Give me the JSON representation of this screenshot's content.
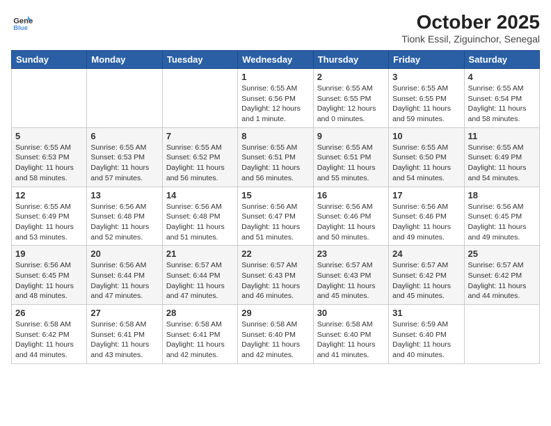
{
  "header": {
    "logo_line1": "General",
    "logo_line2": "Blue",
    "title": "October 2025",
    "subtitle": "Tionk Essil, Ziguinchor, Senegal"
  },
  "weekdays": [
    "Sunday",
    "Monday",
    "Tuesday",
    "Wednesday",
    "Thursday",
    "Friday",
    "Saturday"
  ],
  "weeks": [
    [
      {
        "day": "",
        "info": ""
      },
      {
        "day": "",
        "info": ""
      },
      {
        "day": "",
        "info": ""
      },
      {
        "day": "1",
        "info": "Sunrise: 6:55 AM\nSunset: 6:56 PM\nDaylight: 12 hours\nand 1 minute."
      },
      {
        "day": "2",
        "info": "Sunrise: 6:55 AM\nSunset: 6:55 PM\nDaylight: 12 hours\nand 0 minutes."
      },
      {
        "day": "3",
        "info": "Sunrise: 6:55 AM\nSunset: 6:55 PM\nDaylight: 11 hours\nand 59 minutes."
      },
      {
        "day": "4",
        "info": "Sunrise: 6:55 AM\nSunset: 6:54 PM\nDaylight: 11 hours\nand 58 minutes."
      }
    ],
    [
      {
        "day": "5",
        "info": "Sunrise: 6:55 AM\nSunset: 6:53 PM\nDaylight: 11 hours\nand 58 minutes."
      },
      {
        "day": "6",
        "info": "Sunrise: 6:55 AM\nSunset: 6:53 PM\nDaylight: 11 hours\nand 57 minutes."
      },
      {
        "day": "7",
        "info": "Sunrise: 6:55 AM\nSunset: 6:52 PM\nDaylight: 11 hours\nand 56 minutes."
      },
      {
        "day": "8",
        "info": "Sunrise: 6:55 AM\nSunset: 6:51 PM\nDaylight: 11 hours\nand 56 minutes."
      },
      {
        "day": "9",
        "info": "Sunrise: 6:55 AM\nSunset: 6:51 PM\nDaylight: 11 hours\nand 55 minutes."
      },
      {
        "day": "10",
        "info": "Sunrise: 6:55 AM\nSunset: 6:50 PM\nDaylight: 11 hours\nand 54 minutes."
      },
      {
        "day": "11",
        "info": "Sunrise: 6:55 AM\nSunset: 6:49 PM\nDaylight: 11 hours\nand 54 minutes."
      }
    ],
    [
      {
        "day": "12",
        "info": "Sunrise: 6:55 AM\nSunset: 6:49 PM\nDaylight: 11 hours\nand 53 minutes."
      },
      {
        "day": "13",
        "info": "Sunrise: 6:56 AM\nSunset: 6:48 PM\nDaylight: 11 hours\nand 52 minutes."
      },
      {
        "day": "14",
        "info": "Sunrise: 6:56 AM\nSunset: 6:48 PM\nDaylight: 11 hours\nand 51 minutes."
      },
      {
        "day": "15",
        "info": "Sunrise: 6:56 AM\nSunset: 6:47 PM\nDaylight: 11 hours\nand 51 minutes."
      },
      {
        "day": "16",
        "info": "Sunrise: 6:56 AM\nSunset: 6:46 PM\nDaylight: 11 hours\nand 50 minutes."
      },
      {
        "day": "17",
        "info": "Sunrise: 6:56 AM\nSunset: 6:46 PM\nDaylight: 11 hours\nand 49 minutes."
      },
      {
        "day": "18",
        "info": "Sunrise: 6:56 AM\nSunset: 6:45 PM\nDaylight: 11 hours\nand 49 minutes."
      }
    ],
    [
      {
        "day": "19",
        "info": "Sunrise: 6:56 AM\nSunset: 6:45 PM\nDaylight: 11 hours\nand 48 minutes."
      },
      {
        "day": "20",
        "info": "Sunrise: 6:56 AM\nSunset: 6:44 PM\nDaylight: 11 hours\nand 47 minutes."
      },
      {
        "day": "21",
        "info": "Sunrise: 6:57 AM\nSunset: 6:44 PM\nDaylight: 11 hours\nand 47 minutes."
      },
      {
        "day": "22",
        "info": "Sunrise: 6:57 AM\nSunset: 6:43 PM\nDaylight: 11 hours\nand 46 minutes."
      },
      {
        "day": "23",
        "info": "Sunrise: 6:57 AM\nSunset: 6:43 PM\nDaylight: 11 hours\nand 45 minutes."
      },
      {
        "day": "24",
        "info": "Sunrise: 6:57 AM\nSunset: 6:42 PM\nDaylight: 11 hours\nand 45 minutes."
      },
      {
        "day": "25",
        "info": "Sunrise: 6:57 AM\nSunset: 6:42 PM\nDaylight: 11 hours\nand 44 minutes."
      }
    ],
    [
      {
        "day": "26",
        "info": "Sunrise: 6:58 AM\nSunset: 6:42 PM\nDaylight: 11 hours\nand 44 minutes."
      },
      {
        "day": "27",
        "info": "Sunrise: 6:58 AM\nSunset: 6:41 PM\nDaylight: 11 hours\nand 43 minutes."
      },
      {
        "day": "28",
        "info": "Sunrise: 6:58 AM\nSunset: 6:41 PM\nDaylight: 11 hours\nand 42 minutes."
      },
      {
        "day": "29",
        "info": "Sunrise: 6:58 AM\nSunset: 6:40 PM\nDaylight: 11 hours\nand 42 minutes."
      },
      {
        "day": "30",
        "info": "Sunrise: 6:58 AM\nSunset: 6:40 PM\nDaylight: 11 hours\nand 41 minutes."
      },
      {
        "day": "31",
        "info": "Sunrise: 6:59 AM\nSunset: 6:40 PM\nDaylight: 11 hours\nand 40 minutes."
      },
      {
        "day": "",
        "info": ""
      }
    ]
  ]
}
